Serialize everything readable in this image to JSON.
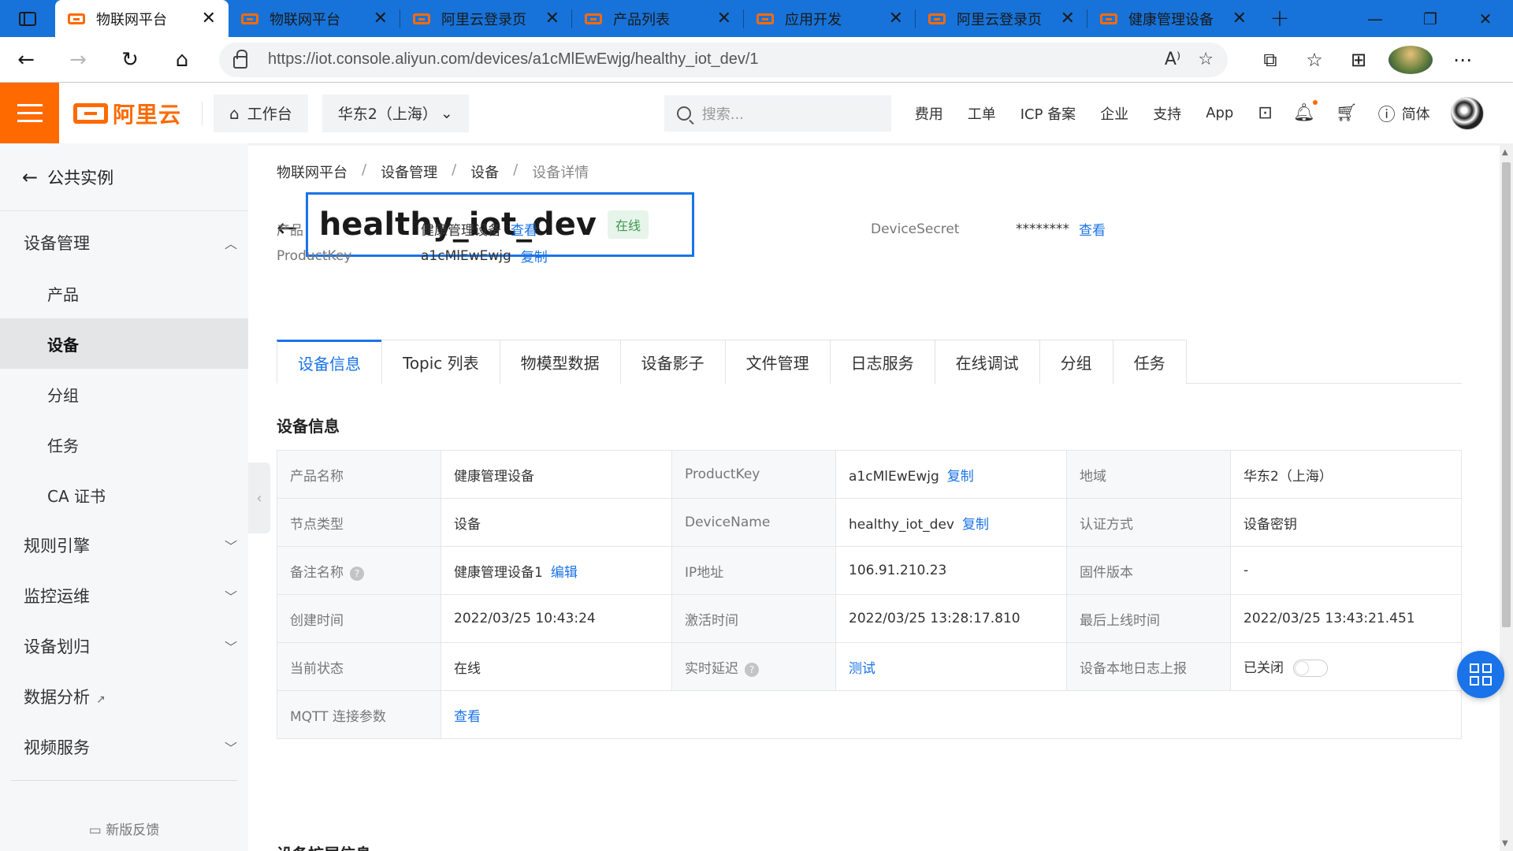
{
  "browser": {
    "tabs": [
      {
        "label": "物联网平台",
        "active": true
      },
      {
        "label": "物联网平台",
        "active": false
      },
      {
        "label": "阿里云登录页",
        "active": false
      },
      {
        "label": "产品列表",
        "active": false
      },
      {
        "label": "应用开发",
        "active": false
      },
      {
        "label": "阿里云登录页",
        "active": false
      },
      {
        "label": "健康管理设备",
        "active": false
      }
    ],
    "url": "https://iot.console.aliyun.com/devices/a1cMlEwEwjg/healthy_iot_dev/1"
  },
  "console": {
    "logo": "阿里云",
    "workbench": "工作台",
    "region": "华东2（上海）",
    "search_placeholder": "搜索...",
    "links": [
      "费用",
      "工单",
      "ICP 备案",
      "企业",
      "支持",
      "App"
    ],
    "lang": "简体"
  },
  "sidebar": {
    "back": "公共实例",
    "groups": [
      {
        "label": "设备管理",
        "expanded": true
      },
      {
        "label": "规则引擎"
      },
      {
        "label": "监控运维"
      },
      {
        "label": "设备划归"
      },
      {
        "label": "数据分析"
      },
      {
        "label": "视频服务"
      }
    ],
    "sub_items": [
      "产品",
      "设备",
      "分组",
      "任务",
      "CA 证书"
    ],
    "active_sub": "设备",
    "feedback": "新版反馈"
  },
  "breadcrumb": [
    "物联网平台",
    "设备管理",
    "设备",
    "设备详情"
  ],
  "device": {
    "name": "healthy_iot_dev",
    "status": "在线",
    "product_label": "产品",
    "product_value": "健康管理设备",
    "product_link": "查看",
    "productkey_label": "ProductKey",
    "productkey_value": "a1cMlEwEwjg",
    "productkey_link": "复制",
    "secret_label": "DeviceSecret",
    "secret_value": "********",
    "secret_link": "查看"
  },
  "tabs": [
    "设备信息",
    "Topic 列表",
    "物模型数据",
    "设备影子",
    "文件管理",
    "日志服务",
    "在线调试",
    "分组",
    "任务"
  ],
  "section_title": "设备信息",
  "info": {
    "r1": {
      "k1": "产品名称",
      "v1": "健康管理设备",
      "k2": "ProductKey",
      "v2": "a1cMlEwEwjg",
      "l2": "复制",
      "k3": "地域",
      "v3": "华东2（上海）"
    },
    "r2": {
      "k1": "节点类型",
      "v1": "设备",
      "k2": "DeviceName",
      "v2": "healthy_iot_dev",
      "l2": "复制",
      "k3": "认证方式",
      "v3": "设备密钥"
    },
    "r3": {
      "k1": "备注名称",
      "v1": "健康管理设备1",
      "l1": "编辑",
      "k2": "IP地址",
      "v2": "106.91.210.23",
      "k3": "固件版本",
      "v3": "-"
    },
    "r4": {
      "k1": "创建时间",
      "v1": "2022/03/25 10:43:24",
      "k2": "激活时间",
      "v2": "2022/03/25 13:28:17.810",
      "k3": "最后上线时间",
      "v3": "2022/03/25 13:43:21.451"
    },
    "r5": {
      "k1": "当前状态",
      "v1": "在线",
      "k2": "实时延迟",
      "l2": "测试",
      "k3": "设备本地日志上报",
      "v3": "已关闭"
    },
    "r6": {
      "k1": "MQTT 连接参数",
      "l1": "查看"
    }
  },
  "next_section": "设备扩展信息"
}
